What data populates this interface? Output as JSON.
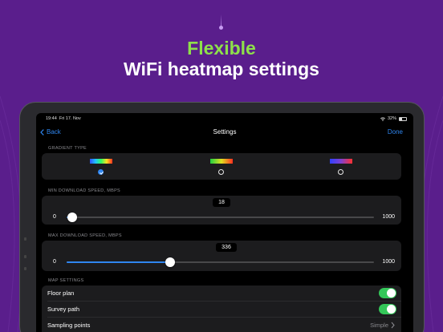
{
  "hero": {
    "accent": "Flexible",
    "title": "WiFi heatmap settings"
  },
  "status_bar": {
    "time": "19:44",
    "date": "Fri 17. Nov",
    "battery": "32%"
  },
  "nav": {
    "back_label": "Back",
    "title": "Settings",
    "done_label": "Done"
  },
  "gradient_type": {
    "label": "GRADIENT TYPE",
    "options": [
      {
        "id": "rainbow",
        "selected": true
      },
      {
        "id": "green-red",
        "selected": false
      },
      {
        "id": "blue-red",
        "selected": false
      }
    ]
  },
  "min_speed": {
    "label": "MIN DOWNLOAD SPEED, MBPS",
    "value": "18",
    "min": "0",
    "max": "1000",
    "fraction": 0.018
  },
  "max_speed": {
    "label": "MAX DOWNLOAD SPEED, MBPS",
    "value": "336",
    "min": "0",
    "max": "1000",
    "fraction": 0.336
  },
  "map_settings": {
    "label": "MAP SETTINGS",
    "floor_plan": {
      "label": "Floor plan",
      "on": true
    },
    "survey_path": {
      "label": "Survey path",
      "on": true
    },
    "sampling_points": {
      "label": "Sampling points",
      "value": "Simple"
    }
  },
  "colors": {
    "background": "#5a1e8c",
    "accent_green": "#8ee04a",
    "ios_blue": "#2f86f0",
    "toggle_green": "#34c759"
  }
}
